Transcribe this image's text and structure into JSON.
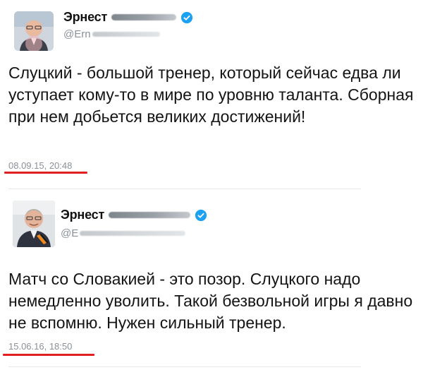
{
  "tweets": [
    {
      "author_name": "Эрнест",
      "handle": "@Ern",
      "text": "Слуцкий - большой тренер, который сейчас едва ли уступает кому-то в мире по уровню таланта. Сборная при нем добьется великих достижений!",
      "timestamp": "08.09.15, 20:48"
    },
    {
      "author_name": "Эрнест",
      "handle": "@E",
      "text": "Матч со Словакией - это позор. Слуцкого надо немедленно уволить. Такой безвольной игры я давно не вспомню. Нужен сильный тренер.",
      "timestamp": "15.06.16, 18:50"
    }
  ],
  "colors": {
    "highlight_underline": "#e02020",
    "verified_badge": "#1da1f2",
    "timestamp_text": "#8a9199"
  },
  "icons": {
    "verified": "verified-badge-icon",
    "avatar": "avatar-photo"
  }
}
